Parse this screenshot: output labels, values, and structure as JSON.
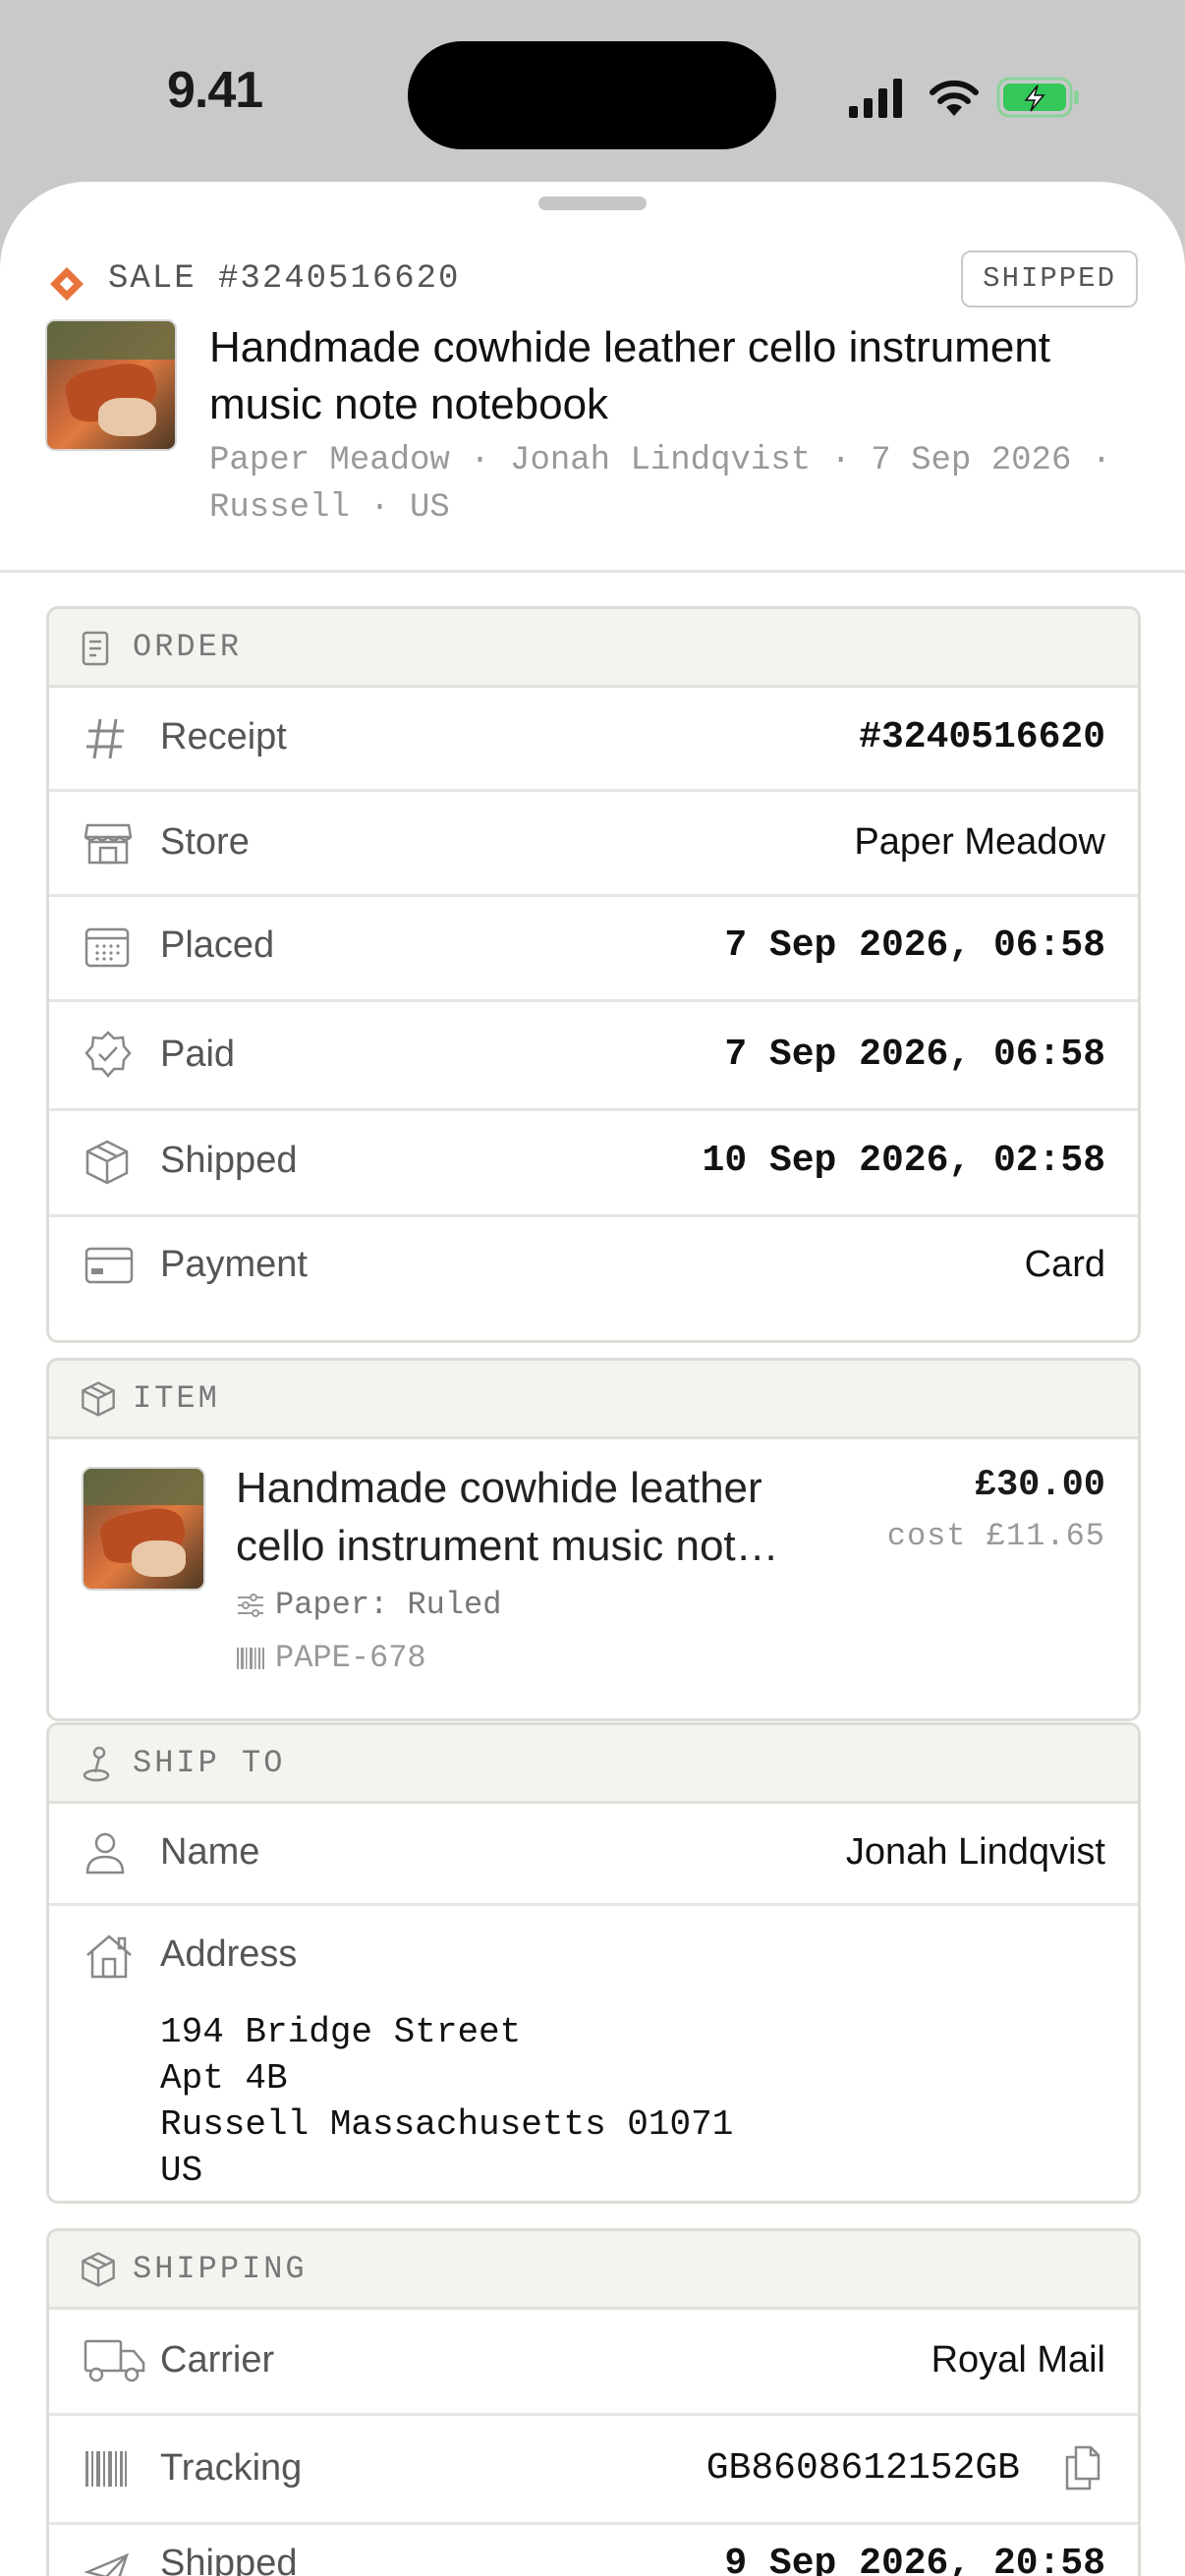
{
  "status_bar": {
    "time": "9.41"
  },
  "header": {
    "sale_label": "SALE #3240516620",
    "status_badge": "SHIPPED",
    "title": "Handmade cowhide leather cello instrument music note notebook",
    "meta": "Paper Meadow · Jonah Lindqvist · 7 Sep 2026 · Russell · US"
  },
  "order": {
    "heading": "ORDER",
    "rows": [
      {
        "label": "Receipt",
        "value": "#3240516620",
        "icon": "hash-icon"
      },
      {
        "label": "Store",
        "value": "Paper Meadow",
        "icon": "store-icon"
      },
      {
        "label": "Placed",
        "value": "7 Sep 2026, 06:58",
        "icon": "calendar-icon"
      },
      {
        "label": "Paid",
        "value": "7 Sep 2026, 06:58",
        "icon": "verified-badge-icon"
      },
      {
        "label": "Shipped",
        "value": "10 Sep 2026, 02:58",
        "icon": "box-icon"
      },
      {
        "label": "Payment",
        "value": "Card",
        "icon": "credit-card-icon"
      }
    ]
  },
  "item": {
    "heading": "ITEM",
    "title": "Handmade cowhide leather cello instrument music not…",
    "price": "£30.00",
    "cost": "cost £11.65",
    "variant": "Paper: Ruled",
    "sku": "PAPE-678"
  },
  "ship_to": {
    "heading": "SHIP TO",
    "name_label": "Name",
    "name_value": "Jonah Lindqvist",
    "address_label": "Address",
    "address_lines": "194 Bridge Street\nApt 4B\nRussell Massachusetts 01071\nUS"
  },
  "shipping": {
    "heading": "SHIPPING",
    "carrier_label": "Carrier",
    "carrier_value": "Royal Mail",
    "tracking_label": "Tracking",
    "tracking_value": "GB8608612152GB",
    "shipped_label": "Shipped",
    "shipped_value": "9 Sep 2026, 20:58"
  },
  "colors": {
    "accent": "#e8743b",
    "battery": "#34c759"
  }
}
